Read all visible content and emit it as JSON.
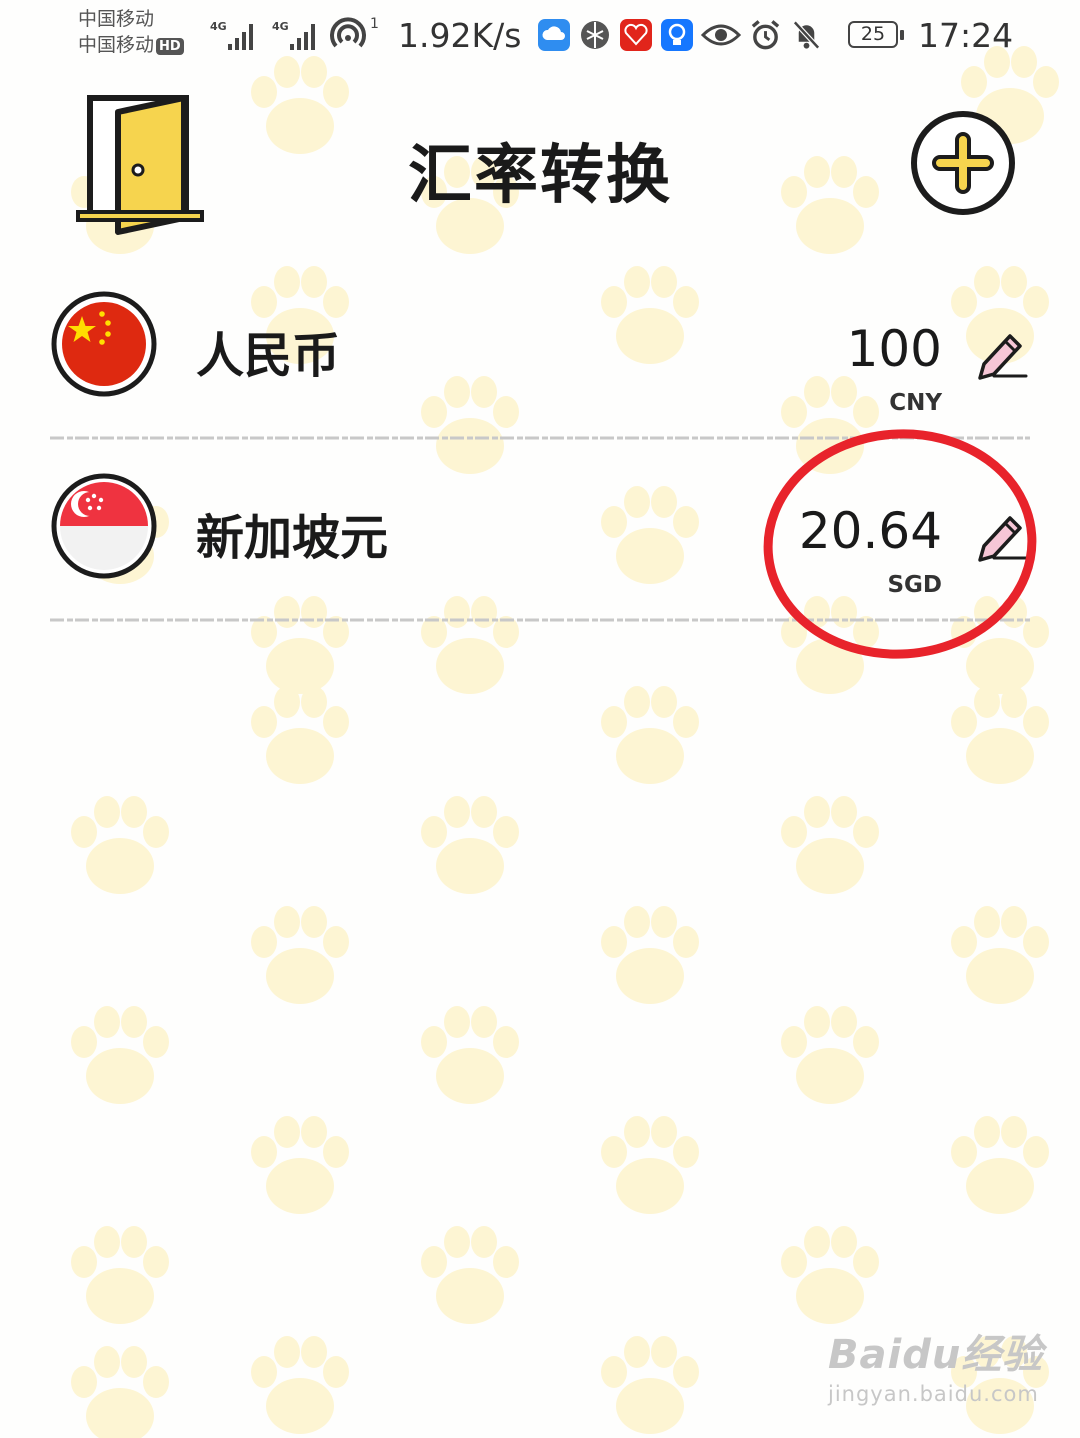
{
  "status_bar": {
    "carrier_1": "中国移动",
    "carrier_2": "中国移动",
    "hd_badge": "HD",
    "net_label_1": "4G",
    "net_label_2": "4G",
    "hotspot_count": "1",
    "speed": "1.92K/s",
    "battery": "25",
    "time": "17:24",
    "icons": [
      "cloud-app-icon",
      "browser-app-icon",
      "shopping-app-icon",
      "bulb-app-icon",
      "eye-icon",
      "alarm-icon",
      "mute-bell-icon"
    ]
  },
  "header": {
    "title": "汇率转换"
  },
  "currencies": [
    {
      "name": "人民币",
      "amount": "100",
      "code": "CNY",
      "flag": "china-flag-icon"
    },
    {
      "name": "新加坡元",
      "amount": "20.64",
      "code": "SGD",
      "flag": "singapore-flag-icon"
    }
  ],
  "annotation": {
    "color": "#e8232b"
  },
  "watermark": {
    "logo": "Baidu经验",
    "url": "jingyan.baidu.com"
  },
  "theme": {
    "paw_color": "#fdf5d2",
    "accent_yellow": "#f6d44e"
  }
}
